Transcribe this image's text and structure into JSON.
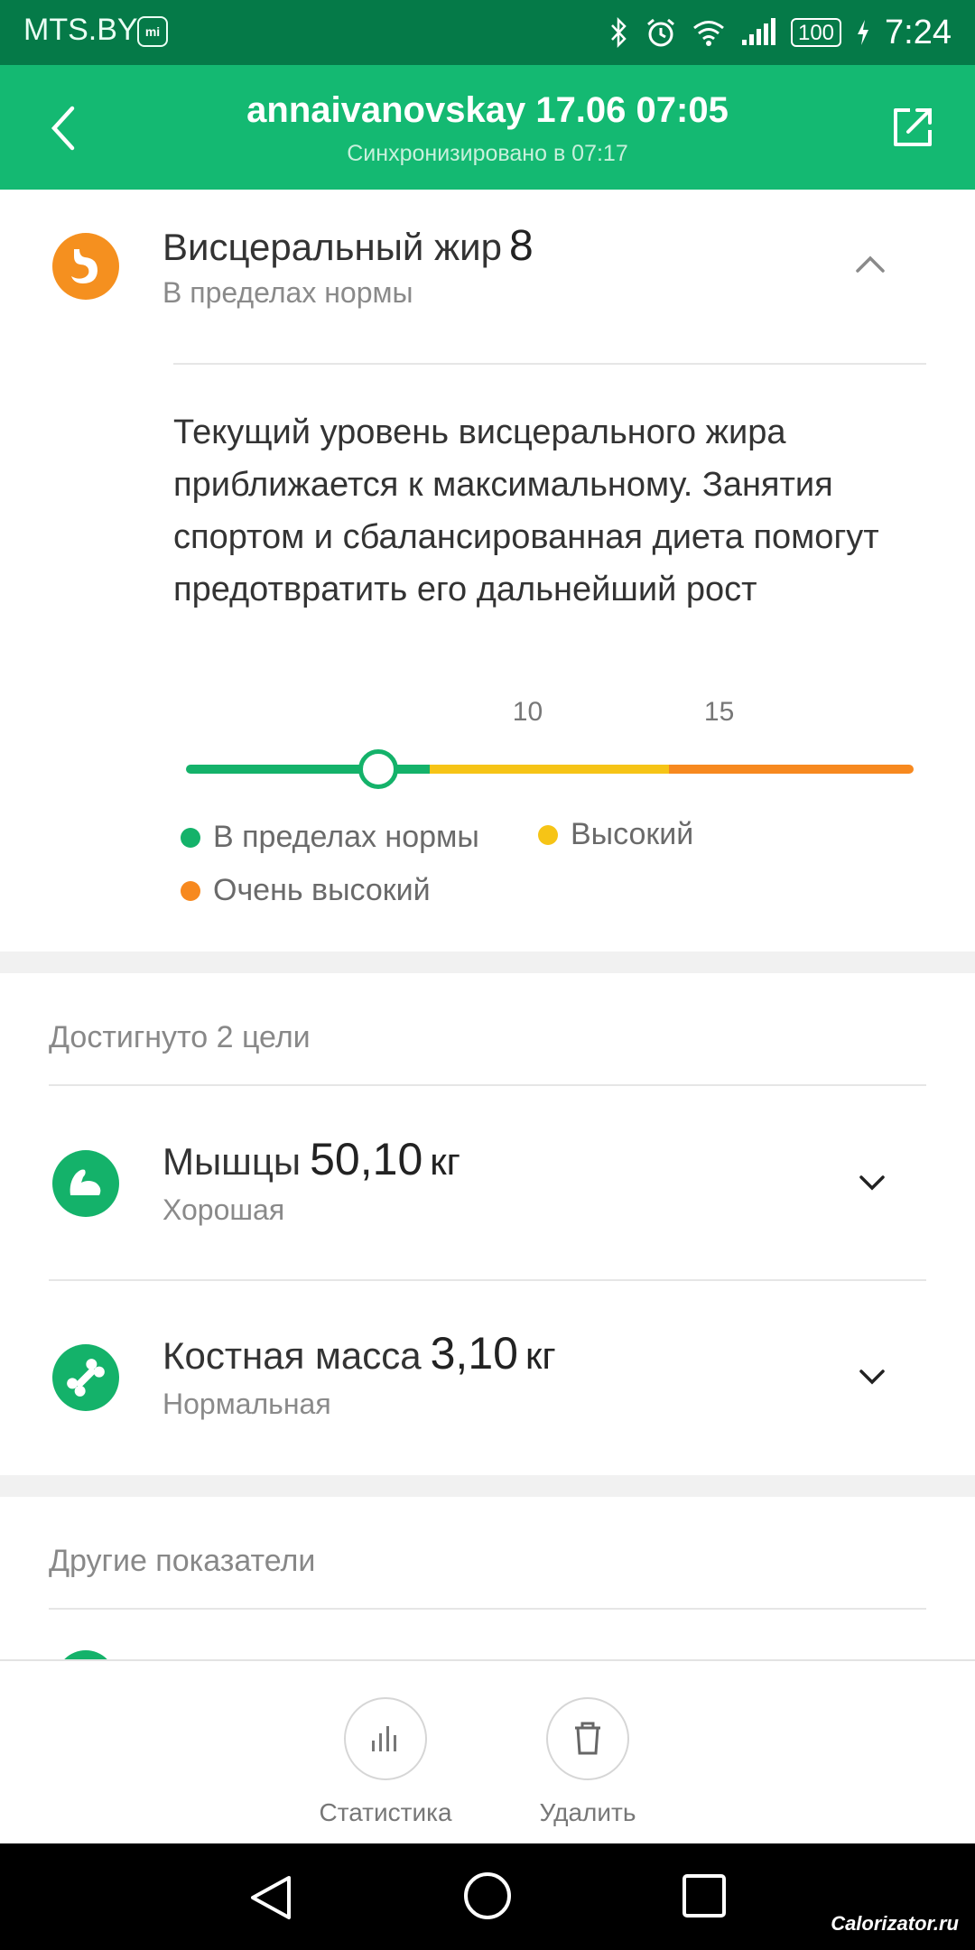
{
  "status_bar": {
    "carrier": "MTS.BY",
    "carrier_badge": "mi",
    "battery": "100",
    "time": "7:24"
  },
  "header": {
    "title": "annaivanovskay 17.06 07:05",
    "subtitle": "Синхронизировано в 07:17"
  },
  "visceral_fat": {
    "title": "Висцеральный жир",
    "value": "8",
    "status": "В пределах нормы",
    "description": "Текущий уровень висцерального жира приближается к максимальному. Занятия спортом и сбалансированная диета помогут предотвратить его дальнейший рост",
    "scale": {
      "min": 1,
      "max": 20,
      "current": 8,
      "thresholds": [
        {
          "value": 10,
          "label": "10"
        },
        {
          "value": 15,
          "label": "15"
        }
      ]
    },
    "legend": [
      {
        "label": "В пределах нормы",
        "color": "#14b26a"
      },
      {
        "label": "Высокий",
        "color": "#f6c416"
      },
      {
        "label": "Очень высокий",
        "color": "#f7891f"
      }
    ]
  },
  "goals": {
    "title": "Достигнуто 2 цели",
    "items": [
      {
        "name": "Мышцы",
        "value": "50,10",
        "unit": "кг",
        "status": "Хорошая",
        "icon": "muscle-icon"
      },
      {
        "name": "Костная масса",
        "value": "3,10",
        "unit": "кг",
        "status": "Нормальная",
        "icon": "bone-icon"
      }
    ]
  },
  "other": {
    "title": "Другие показатели"
  },
  "toolbar": {
    "stats_label": "Статистика",
    "delete_label": "Удалить"
  },
  "watermark": "Calorizator.ru",
  "colors": {
    "status_bar": "#057a48",
    "header": "#14b972",
    "normal": "#14b26a",
    "high": "#f6c416",
    "very_high": "#f7891f",
    "visceral_icon": "#f5901f"
  }
}
